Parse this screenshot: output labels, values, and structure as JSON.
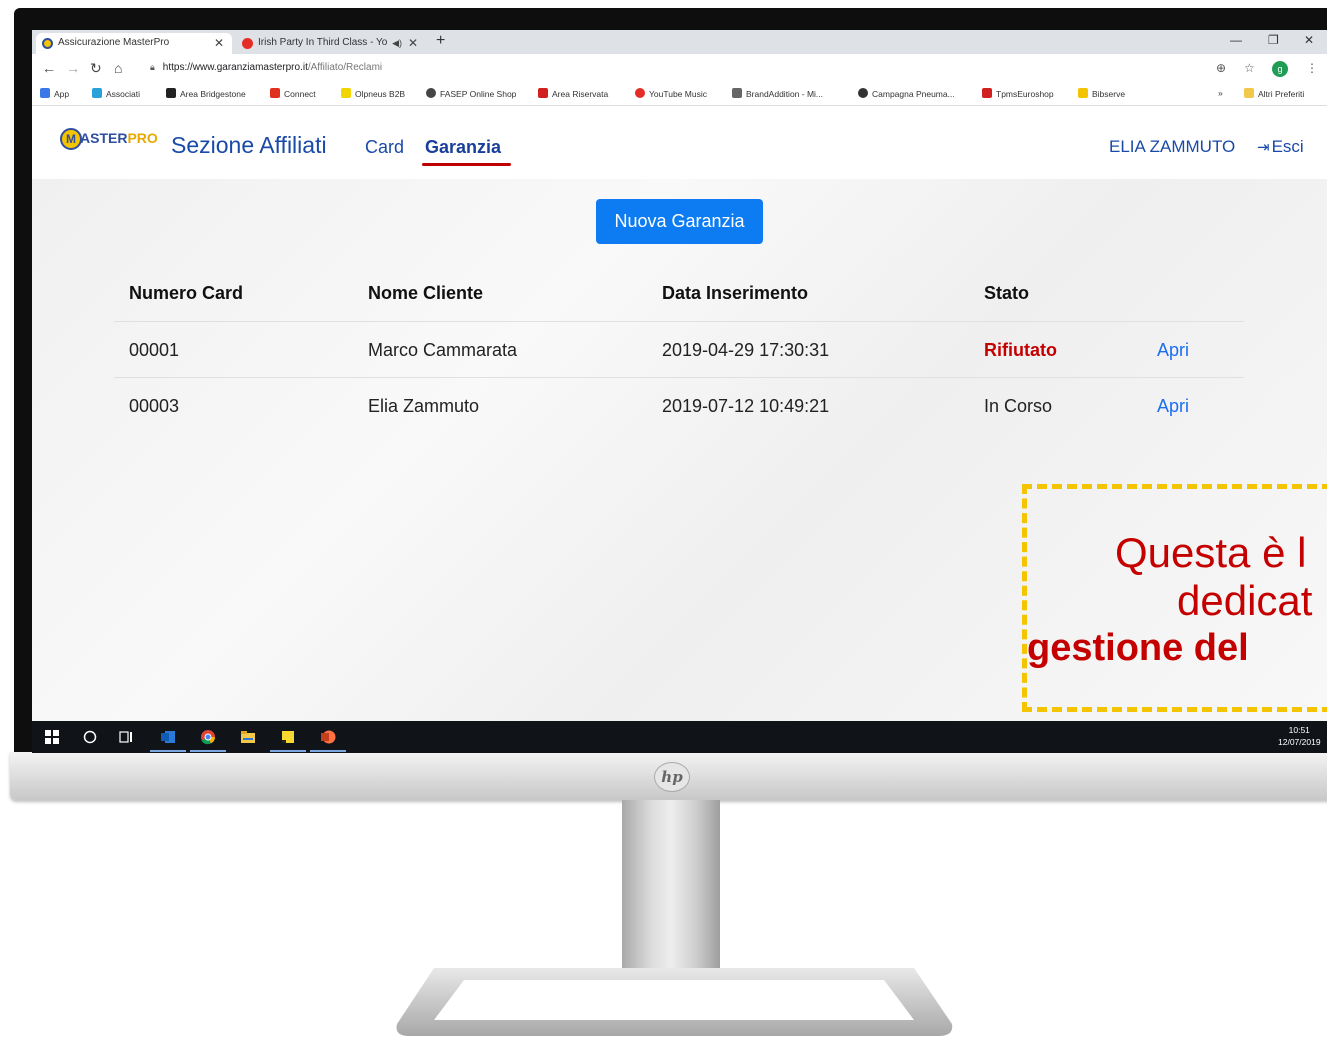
{
  "browser": {
    "tabs": [
      {
        "title": "Assicurazione MasterPro",
        "icon": "masterpro-favicon"
      },
      {
        "title": "Irish Party In Third Class - Yo",
        "icon": "youtube-favicon"
      }
    ],
    "url_host": "https://www.garanziamasterpro.it",
    "url_path": "/Affiliato/Reclami",
    "profile_initial": "g",
    "bookmarks": [
      "App",
      "Associati",
      "Area Bridgestone",
      "Connect",
      "Olpneus B2B",
      "FASEP Online Shop",
      "Area Riservata",
      "YouTube Music",
      "BrandAddition - Mi...",
      "Campagna Pneuma...",
      "TpmsEuroshop",
      "Bibserve"
    ],
    "bookmarks_more": "»",
    "other_bookmarks": "Altri Preferiti"
  },
  "site": {
    "logo_text_a": "M",
    "logo_text_b": "ASTER",
    "logo_text_c": "PRO",
    "brand": "Sezione Affiliati",
    "nav": {
      "card": "Card",
      "garanzia": "Garanzia"
    },
    "user": "ELIA ZAMMUTO",
    "logout": "Esci"
  },
  "main": {
    "new_button": "Nuova Garanzia",
    "table": {
      "headers": [
        "Numero Card",
        "Nome Cliente",
        "Data Inserimento",
        "Stato"
      ],
      "rows": [
        {
          "card": "00001",
          "cliente": "Marco Cammarata",
          "data": "2019-04-29 17:30:31",
          "stato": "Rifiutato",
          "azione": "Apri"
        },
        {
          "card": "00003",
          "cliente": "Elia Zammuto",
          "data": "2019-07-12 10:49:21",
          "stato": "In Corso",
          "azione": "Apri"
        }
      ]
    }
  },
  "callout": {
    "line1": "Questa è l",
    "line2": "dedicat",
    "line3": "gestione del"
  },
  "taskbar": {
    "time": "10:51",
    "date": "12/07/2019"
  },
  "colors": {
    "accent": "#1a4aa8",
    "button": "#0d7cf2",
    "rejected": "#c40000",
    "callout_border": "#f5c400"
  }
}
